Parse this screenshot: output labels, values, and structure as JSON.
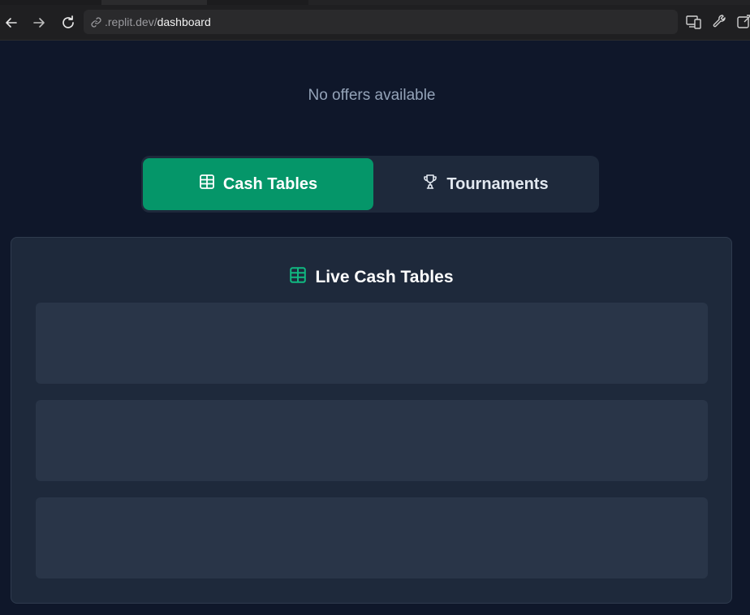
{
  "browser": {
    "url_host": ".replit.dev/",
    "url_path": "dashboard",
    "icons": [
      "back-arrow-icon",
      "forward-arrow-icon",
      "reload-icon",
      "link-icon",
      "devices-icon",
      "wrench-icon",
      "external-link-icon"
    ]
  },
  "page": {
    "no_offers_text": "No offers available",
    "tabs": [
      {
        "label": "Cash Tables",
        "icon": "table-icon",
        "active": true
      },
      {
        "label": "Tournaments",
        "icon": "trophy-icon",
        "active": false
      }
    ],
    "panel": {
      "title": "Live Cash Tables",
      "icon": "table-icon"
    }
  },
  "colors": {
    "background": "#0f172a",
    "panel": "#1e293b",
    "accent": "#059669",
    "skeleton": "#293548"
  }
}
